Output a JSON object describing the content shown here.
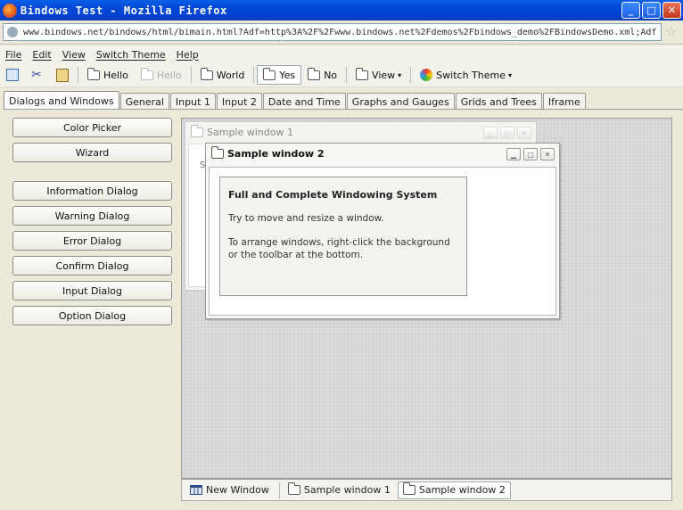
{
  "window": {
    "title": "Bindows Test - Mozilla Firefox",
    "controls": [
      "_",
      "□",
      "✕"
    ]
  },
  "urlbar": {
    "url": "www.bindows.net/bindows/html/bimain.html?Adf=http%3A%2F%2Fwww.bindows.net%2Fdemos%2Fbindows_demo%2FBindowsDemo.xml;Adf"
  },
  "menu": {
    "items": [
      "File",
      "Edit",
      "View",
      "Switch Theme",
      "Help"
    ]
  },
  "toolbar": {
    "hello_pressed": "Hello",
    "hello_disabled": "Hello",
    "world": "World",
    "yes": "Yes",
    "no": "No",
    "view": "View",
    "switch_theme": "Switch Theme"
  },
  "tabs": [
    "Dialogs and Windows",
    "General",
    "Input 1",
    "Input 2",
    "Date and Time",
    "Graphs and Gauges",
    "Grids and Trees",
    "Iframe"
  ],
  "left_buttons": {
    "color_picker": "Color Picker",
    "wizard": "Wizard",
    "information": "Information Dialog",
    "warning": "Warning Dialog",
    "error": "Error Dialog",
    "confirm": "Confirm Dialog",
    "input": "Input Dialog",
    "option": "Option Dialog"
  },
  "window1": {
    "title": "Sample window 1",
    "text_fragment": "Sc"
  },
  "window2": {
    "title": "Sample window 2",
    "heading": "Full and Complete Windowing System",
    "line1": "Try to move and resize a window.",
    "line2": "To arrange windows, right-click the background or the toolbar at the bottom."
  },
  "taskbar": {
    "new_window": "New Window",
    "task1": "Sample window 1",
    "task2": "Sample window 2"
  }
}
